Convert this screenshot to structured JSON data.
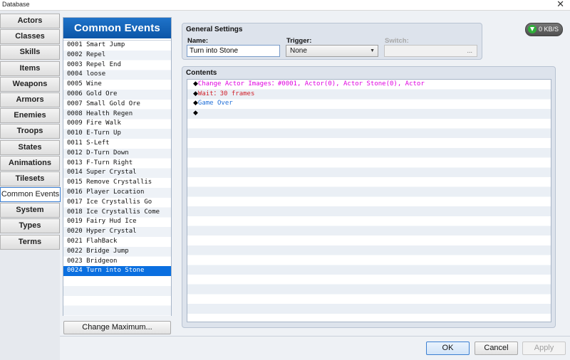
{
  "window": {
    "title": "Database",
    "close_glyph": "✕"
  },
  "tabs": [
    {
      "label": "Actors"
    },
    {
      "label": "Classes"
    },
    {
      "label": "Skills"
    },
    {
      "label": "Items"
    },
    {
      "label": "Weapons"
    },
    {
      "label": "Armors"
    },
    {
      "label": "Enemies"
    },
    {
      "label": "Troops"
    },
    {
      "label": "States"
    },
    {
      "label": "Animations"
    },
    {
      "label": "Tilesets"
    },
    {
      "label": "Common Events",
      "active": true
    },
    {
      "label": "System"
    },
    {
      "label": "Types"
    },
    {
      "label": "Terms"
    }
  ],
  "list": {
    "header": "Common Events",
    "items": [
      "0001 Smart Jump",
      "0002 Repel",
      "0003 Repel End",
      "0004 loose",
      "0005 Wine",
      "0006 Gold Ore",
      "0007 Small Gold Ore",
      "0008 Health Regen",
      "0009 Fire Walk",
      "0010 E-Turn Up",
      "0011 S-Left",
      "0012 D-Turn Down",
      "0013 F-Turn Right",
      "0014 Super Crystal",
      "0015 Remove Crystallis",
      "0016 Player Location",
      "0017 Ice Crystallis Go",
      "0018 Ice Crystallis Come",
      "0019 Fairy Hud Ice",
      "0020 Hyper Crystal",
      "0021 FlahBack",
      "0022 Bridge Jump",
      "0023 Bridgeon",
      "0024 Turn into Stone"
    ],
    "selected_index": 23,
    "change_max_label": "Change Maximum..."
  },
  "general": {
    "title": "General Settings",
    "name_label": "Name:",
    "name_value": "Turn into Stone",
    "trigger_label": "Trigger:",
    "trigger_value": "None",
    "switch_label": "Switch:",
    "switch_button": "..."
  },
  "contents": {
    "title": "Contents",
    "commands": [
      {
        "text": "Change Actor Images：#0001, Actor(0), Actor Stone(0), Actor",
        "color": "#e000e0"
      },
      {
        "text": "Wait：30 frames",
        "color": "#d0202a"
      },
      {
        "text": "Game Over",
        "color": "#1f6fd8"
      },
      {
        "text": "",
        "color": "#000000"
      }
    ],
    "diamond": "◆"
  },
  "net": {
    "label": "0 KB/S",
    "icon": "download-arrow-icon"
  },
  "footer": {
    "ok": "OK",
    "cancel": "Cancel",
    "apply": "Apply"
  },
  "colors": {
    "accent": "#0b55a7",
    "selected": "#0a6fe0"
  }
}
